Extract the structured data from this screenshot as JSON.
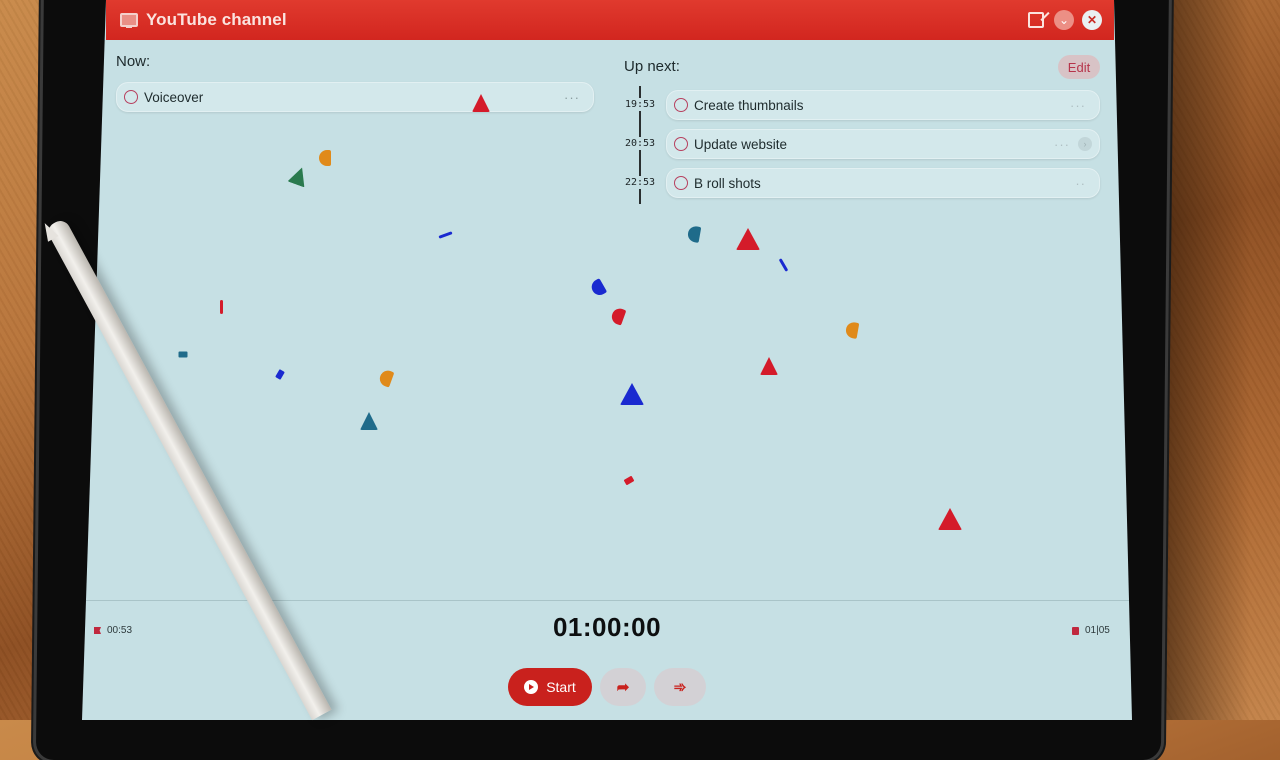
{
  "header": {
    "app_icon": "monitor-icon",
    "title": "YouTube channel",
    "actions": [
      {
        "name": "compose-icon",
        "label": ""
      },
      {
        "name": "chevron-down-icon",
        "label": "⌄"
      },
      {
        "name": "close-icon",
        "label": "✕"
      }
    ]
  },
  "now": {
    "label": "Now:",
    "task": {
      "title": "Voiceover",
      "menu": "···"
    }
  },
  "up_next": {
    "label": "Up next:",
    "edit_label": "Edit",
    "tasks": [
      {
        "time": "19:53",
        "title": "Create thumbnails",
        "menu": "···"
      },
      {
        "time": "20:53",
        "title": "Update website",
        "menu": "···",
        "chevron": "›"
      },
      {
        "time": "22:53",
        "title": "B roll shots",
        "menu": "··"
      }
    ]
  },
  "footer": {
    "elapsed": "00:53",
    "elapsed_icon": "flag-icon",
    "timer": "01:00:00",
    "count": "01|05",
    "count_icon": "stop-icon",
    "start_label": "Start",
    "skip_label": "➦",
    "skip_all_label": "➾"
  },
  "colors": {
    "accent": "#d2261f",
    "screen_bg": "#c6e0e4",
    "card_bg": "#d3e8eb",
    "edit_text": "#b6354b"
  },
  "confetti": [
    {
      "color": "#e08a1a",
      "shape": "arc"
    },
    {
      "color": "#2a7a4e",
      "shape": "tri"
    },
    {
      "color": "#1a2ad0",
      "shape": "sliver"
    },
    {
      "color": "#d41b2a",
      "shape": "sliver"
    },
    {
      "color": "#1f6b8a",
      "shape": "chip"
    },
    {
      "color": "#1a2ad0",
      "shape": "chip"
    },
    {
      "color": "#e08a1a",
      "shape": "arc"
    },
    {
      "color": "#1f6b8a",
      "shape": "tri"
    },
    {
      "color": "#1a2ad0",
      "shape": "arc"
    },
    {
      "color": "#d41b2a",
      "shape": "arc"
    },
    {
      "color": "#1a2ad0",
      "shape": "tri"
    },
    {
      "color": "#d41b2a",
      "shape": "tri"
    },
    {
      "color": "#1f6b8a",
      "shape": "arc"
    },
    {
      "color": "#1a2ad0",
      "shape": "sliver"
    },
    {
      "color": "#e08a1a",
      "shape": "arc"
    },
    {
      "color": "#d41b2a",
      "shape": "tri"
    },
    {
      "color": "#d41b2a",
      "shape": "tri"
    },
    {
      "color": "#d41b2a",
      "shape": "chip"
    },
    {
      "color": "#d41b2a",
      "shape": "tri"
    }
  ]
}
